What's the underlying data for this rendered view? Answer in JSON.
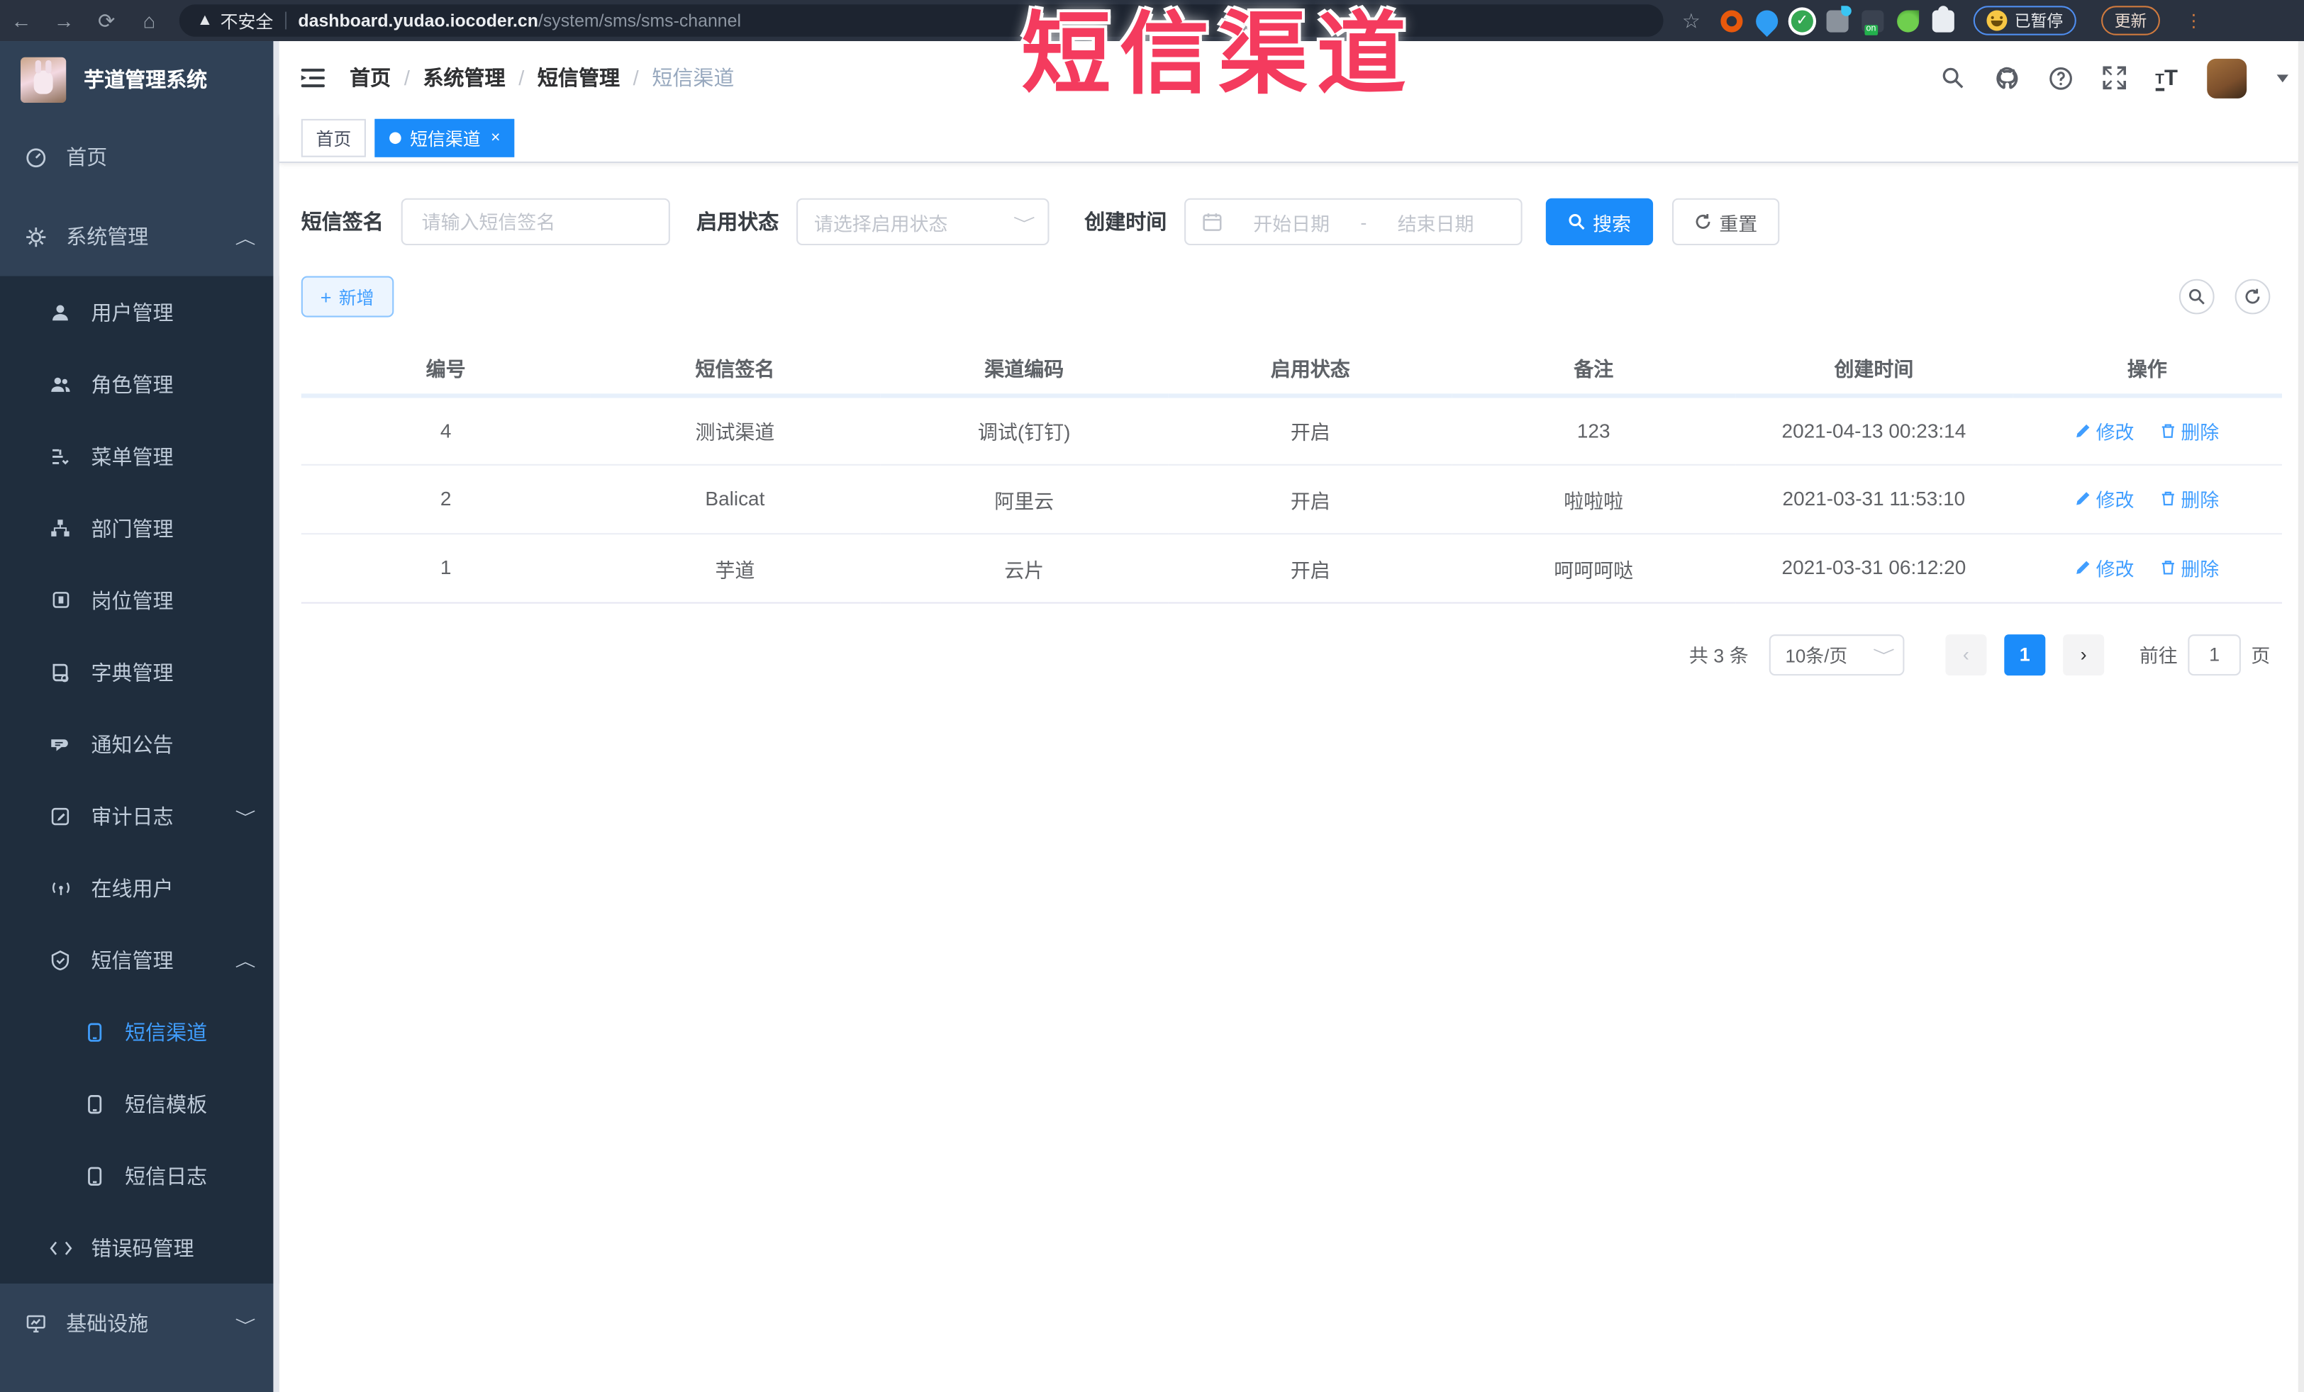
{
  "browser": {
    "security_label": "不安全",
    "url_domain": "dashboard.yudao.iocoder.cn",
    "url_path": "/system/sms/sms-channel",
    "paused_badge": "已暂停",
    "update_button": "更新"
  },
  "annotation": {
    "text": "短信渠道",
    "color": "#f43b5e"
  },
  "sidebar": {
    "app_title": "芋道管理系统",
    "items": [
      {
        "label": "首页",
        "icon": "dashboard-icon",
        "level": 1,
        "active": false
      },
      {
        "label": "系统管理",
        "icon": "gear-icon",
        "level": 1,
        "active": false,
        "arrow": "up"
      },
      {
        "label": "用户管理",
        "icon": "user-icon",
        "level": 2,
        "active": false
      },
      {
        "label": "角色管理",
        "icon": "people-icon",
        "level": 2,
        "active": false
      },
      {
        "label": "菜单管理",
        "icon": "menu-list-icon",
        "level": 2,
        "active": false
      },
      {
        "label": "部门管理",
        "icon": "org-tree-icon",
        "level": 2,
        "active": false
      },
      {
        "label": "岗位管理",
        "icon": "badge-icon",
        "level": 2,
        "active": false
      },
      {
        "label": "字典管理",
        "icon": "book-icon",
        "level": 2,
        "active": false
      },
      {
        "label": "通知公告",
        "icon": "bullhorn-icon",
        "level": 2,
        "active": false
      },
      {
        "label": "审计日志",
        "icon": "log-edit-icon",
        "level": 2,
        "active": false,
        "arrow": "down"
      },
      {
        "label": "在线用户",
        "icon": "online-icon",
        "level": 2,
        "active": false
      },
      {
        "label": "短信管理",
        "icon": "sms-shield-icon",
        "level": 2,
        "active": false,
        "arrow": "up"
      },
      {
        "label": "短信渠道",
        "icon": "phone-icon",
        "level": 3,
        "active": true
      },
      {
        "label": "短信模板",
        "icon": "phone-icon",
        "level": 3,
        "active": false
      },
      {
        "label": "短信日志",
        "icon": "phone-icon",
        "level": 3,
        "active": false
      },
      {
        "label": "错误码管理",
        "icon": "code-icon",
        "level": 2,
        "active": false
      },
      {
        "label": "基础设施",
        "icon": "monitor-icon",
        "level": 1,
        "active": false,
        "arrow": "down"
      }
    ]
  },
  "header": {
    "breadcrumb": [
      {
        "label": "首页"
      },
      {
        "label": "系统管理"
      },
      {
        "label": "短信管理"
      },
      {
        "label": "短信渠道"
      }
    ]
  },
  "tags": [
    {
      "label": "首页",
      "active": false
    },
    {
      "label": "短信渠道",
      "active": true,
      "close": "×"
    }
  ],
  "filters": {
    "sign_label": "短信签名",
    "sign_placeholder": "请输入短信签名",
    "status_label": "启用状态",
    "status_placeholder": "请选择启用状态",
    "time_label": "创建时间",
    "start_placeholder": "开始日期",
    "range_separator": "-",
    "end_placeholder": "结束日期",
    "search_label": "搜索",
    "reset_label": "重置"
  },
  "toolbar": {
    "add_label": "新增"
  },
  "table": {
    "headers": [
      "编号",
      "短信签名",
      "渠道编码",
      "启用状态",
      "备注",
      "创建时间",
      "操作"
    ],
    "edit_label": "修改",
    "delete_label": "删除",
    "rows": [
      {
        "id": "4",
        "sign": "测试渠道",
        "code": "调试(钉钉)",
        "status": "开启",
        "remark": "123",
        "created": "2021-04-13 00:23:14"
      },
      {
        "id": "2",
        "sign": "Balicat",
        "code": "阿里云",
        "status": "开启",
        "remark": "啦啦啦",
        "created": "2021-03-31 11:53:10"
      },
      {
        "id": "1",
        "sign": "芋道",
        "code": "云片",
        "status": "开启",
        "remark": "呵呵呵哒",
        "created": "2021-03-31 06:12:20"
      }
    ]
  },
  "pagination": {
    "total_text": "共 3 条",
    "page_size": "10条/页",
    "current_page": "1",
    "goto_label": "前往",
    "goto_value": "1",
    "page_unit": "页"
  },
  "colors": {
    "primary_blue": "#1b8cfa",
    "link_blue": "#409EFF",
    "sidebar_bg": "#304156",
    "submenu_bg": "#1f2d3d",
    "sidebar_text": "#bfcbd9",
    "annotation_red": "#f43b5e"
  },
  "icons": {
    "security_warning": "⚠",
    "star": "☆",
    "browser_menu": "⋮",
    "caret_down": "▾",
    "chevron_up": "︿",
    "chevron_down": "﹀",
    "breadcrumb_separator": "/",
    "prev_page": "‹",
    "next_page": "›",
    "plus": "+",
    "close": "×"
  }
}
